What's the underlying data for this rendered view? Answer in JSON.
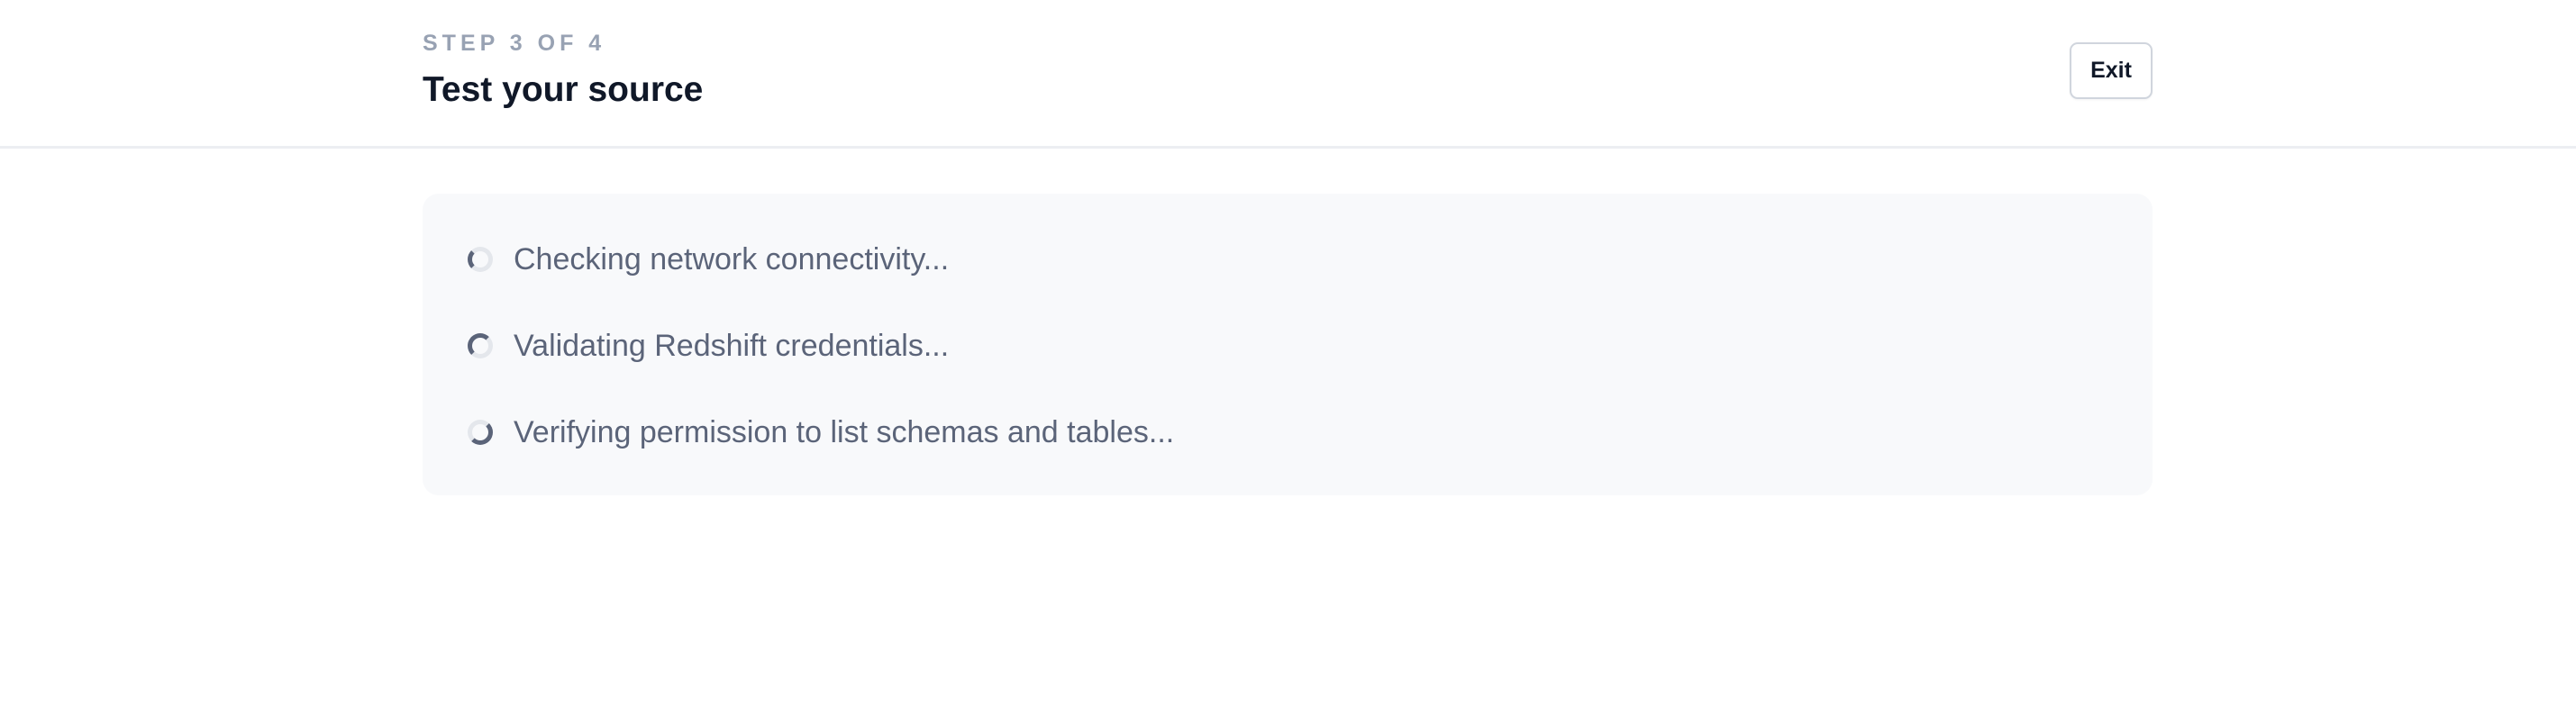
{
  "header": {
    "step_label": "STEP 3 OF 4",
    "title": "Test your source",
    "exit_label": "Exit"
  },
  "checks": [
    {
      "label": "Checking network connectivity...",
      "status": "in-progress"
    },
    {
      "label": "Validating Redshift credentials...",
      "status": "in-progress"
    },
    {
      "label": "Verifying permission to list schemas and tables...",
      "status": "in-progress"
    }
  ],
  "colors": {
    "title": "#101828",
    "step_label": "#98a2b3",
    "check_text": "#5b6479",
    "panel_background": "#f8f9fb",
    "spinner_track": "#e4e7ec",
    "spinner_active": "#5b6479"
  }
}
